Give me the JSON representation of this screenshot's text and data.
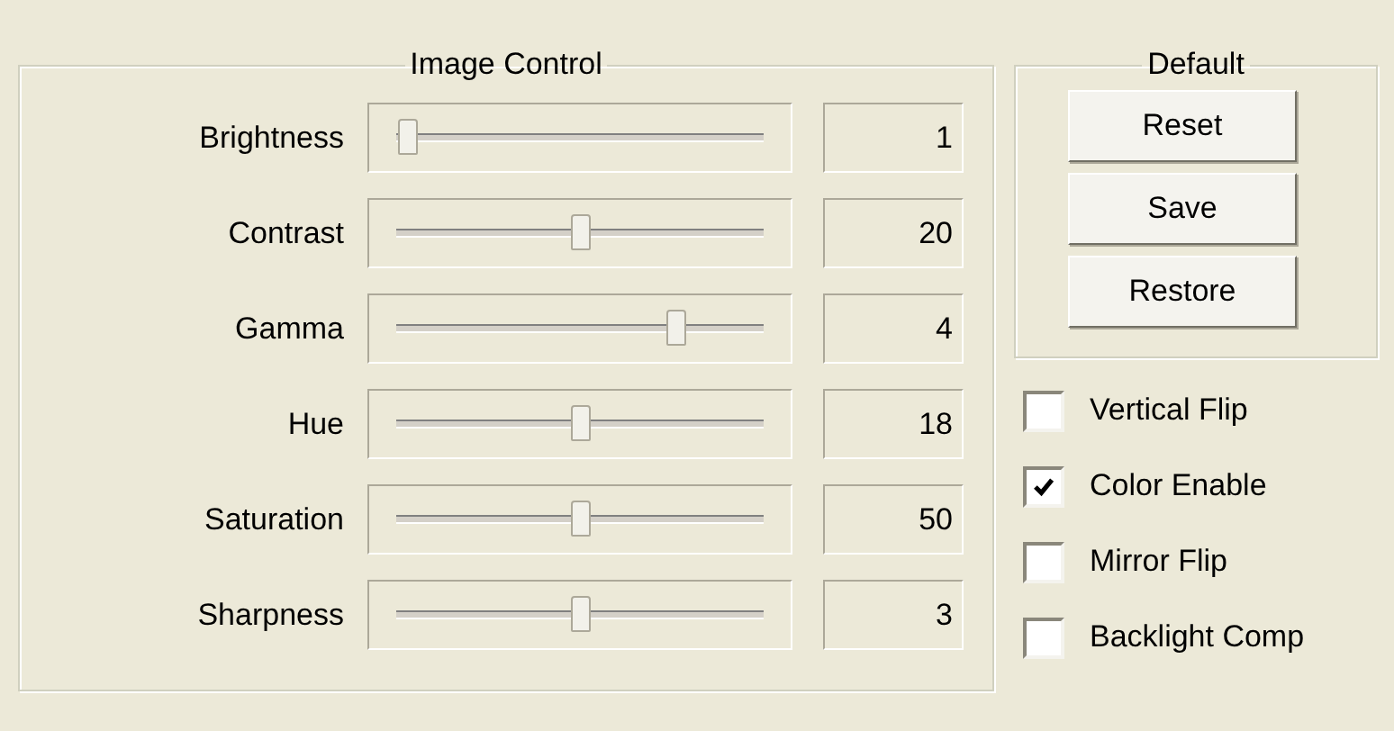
{
  "image_control": {
    "title": "Image Control",
    "sliders": [
      {
        "label": "Brightness",
        "level": 0.03,
        "value": "1"
      },
      {
        "label": "Contrast",
        "level": 0.5,
        "value": "20"
      },
      {
        "label": "Gamma",
        "level": 0.76,
        "value": "4"
      },
      {
        "label": "Hue",
        "level": 0.5,
        "value": "18"
      },
      {
        "label": "Saturation",
        "level": 0.5,
        "value": "50"
      },
      {
        "label": "Sharpness",
        "level": 0.5,
        "value": "3"
      }
    ]
  },
  "default": {
    "title": "Default",
    "buttons": [
      "Reset",
      "Save",
      "Restore"
    ]
  },
  "options": [
    {
      "label": "Vertical Flip",
      "checked": false
    },
    {
      "label": "Color Enable",
      "checked": true
    },
    {
      "label": "Mirror Flip",
      "checked": false
    },
    {
      "label": "Backlight Comp",
      "checked": false
    }
  ]
}
